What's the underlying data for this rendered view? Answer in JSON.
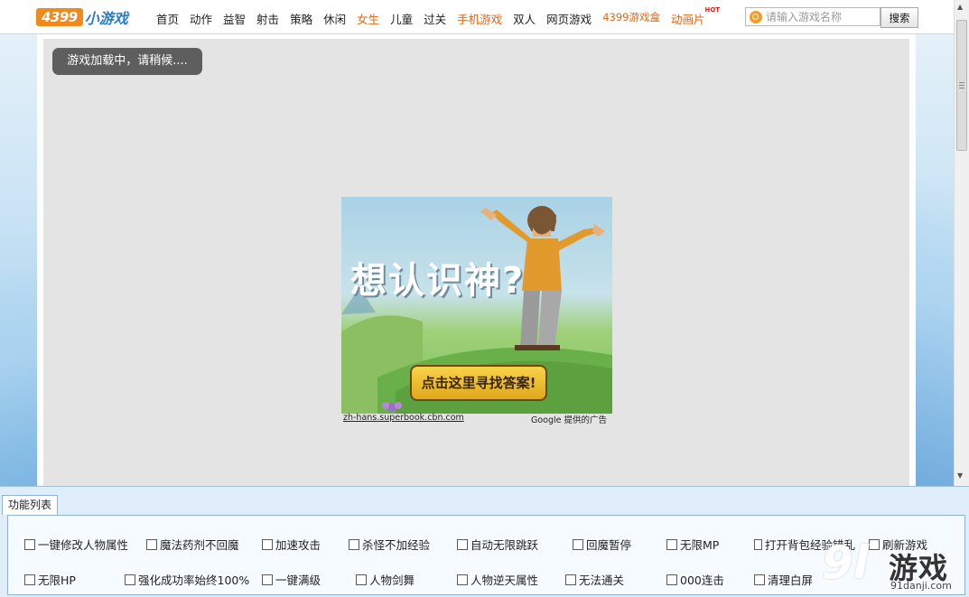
{
  "topnav": {
    "logo_num": "4399",
    "logo_text": "小游戏",
    "items": [
      {
        "label": "首页",
        "style": "normal"
      },
      {
        "label": "动作",
        "style": "normal"
      },
      {
        "label": "益智",
        "style": "normal"
      },
      {
        "label": "射击",
        "style": "normal"
      },
      {
        "label": "策略",
        "style": "normal"
      },
      {
        "label": "休闲",
        "style": "normal"
      },
      {
        "label": "女生",
        "style": "orange"
      },
      {
        "label": "儿童",
        "style": "normal"
      },
      {
        "label": "过关",
        "style": "normal"
      },
      {
        "label": "手机游戏",
        "style": "orange"
      },
      {
        "label": "双人",
        "style": "normal"
      },
      {
        "label": "网页游戏",
        "style": "normal"
      },
      {
        "label": "4399游戏盒",
        "style": "orange-small"
      },
      {
        "label": "动画片",
        "style": "orange"
      }
    ],
    "hot_badge": "HOT",
    "search_placeholder": "请输入游戏名称",
    "search_button": "搜索"
  },
  "game": {
    "loading_text": "游戏加载中，请稍候...."
  },
  "ad": {
    "headline": "想认识神?",
    "cta": "点击这里寻找答案!",
    "link": "zh-hans.superbook.cbn.com",
    "credit": "Google 提供的广告",
    "colors": {
      "sky": "#a9d2e6",
      "grass": "#7fc25a",
      "button": "#f0c234"
    }
  },
  "panel": {
    "tab_label": "功能列表",
    "row1": [
      "一键修改人物属性",
      "魔法药剂不回魔",
      "加速攻击",
      "杀怪不加经验",
      "自动无限跳跃",
      "回魔暂停",
      "无限MP",
      "打开背包经验错乱",
      "刷新游戏"
    ],
    "row2": [
      "无限HP",
      "强化成功率始终100%",
      "一键满级",
      "人物剑舞",
      "人物逆天属性",
      "无法通关",
      "000连击",
      "清理白屏"
    ]
  },
  "watermark": {
    "num": "9l",
    "text": "游戏",
    "sub": "91danji.com"
  }
}
